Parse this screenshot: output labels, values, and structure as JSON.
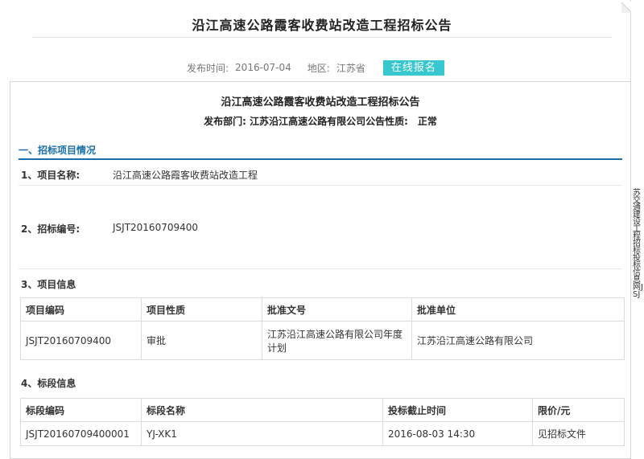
{
  "header": {
    "title": "沿江高速公路霞客收费站改造工程招标公告",
    "publish_label": "发布时间:",
    "publish_date": "2016-07-04",
    "region_label": "地区:",
    "region_value": "江苏省",
    "online_button": "在线报名"
  },
  "notice": {
    "title": "沿江高速公路霞客收费站改造工程招标公告",
    "subline": "发布部门: 江苏沿江高速公路有限公司公告性质:　正常",
    "section1_heading": "一、招标项目情况",
    "item1_label": "1、项目名称:",
    "item1_value": "沿江高速公路霞客收费站改造工程",
    "item2_label": "2、招标编号:",
    "item2_value": "JSJT20160709400",
    "item3_label": "3、项目信息",
    "project_table": {
      "headers": [
        "项目编码",
        "项目性质",
        "批准文号",
        "批准单位"
      ],
      "row": [
        "JSJT20160709400",
        "审批",
        "江苏沿江高速公路有限公司年度计划",
        "江苏沿江高速公路有限公司"
      ]
    },
    "item4_label": "4、标段信息",
    "section_table": {
      "headers": [
        "标段编码",
        "标段名称",
        "投标截止时间",
        "限价/元"
      ],
      "row": [
        "JSJT20160709400001",
        "YJ-XK1",
        "2016-08-03 14:30",
        "见招标文件"
      ]
    }
  },
  "side_strip": {
    "text": "苏交通建设工程招标投标信息网JSJ"
  }
}
